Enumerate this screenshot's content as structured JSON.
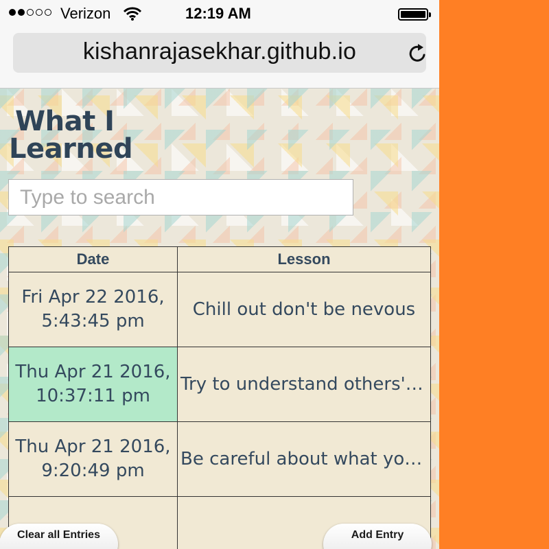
{
  "status_bar": {
    "signal_dots_filled": 2,
    "signal_dots_total": 5,
    "carrier": "Verizon",
    "time": "12:19 AM",
    "battery_level": 1.0
  },
  "browser": {
    "url": "kishanrajasekhar.github.io",
    "icons": [
      "wifi-icon",
      "reload-icon",
      "battery-icon"
    ]
  },
  "page": {
    "title_line1": "What I",
    "title_line2": "Learned",
    "search_placeholder": "Type to search"
  },
  "table": {
    "columns": [
      "Date",
      "Lesson"
    ],
    "rows": [
      {
        "date_line1": "Fri Apr 22 2016,",
        "date_line2": "5:43:45 pm",
        "lesson": "Chill out don't be nevous"
      },
      {
        "date_line1": "Thu Apr 21 2016,",
        "date_line2": "10:37:11 pm",
        "lesson": "Try to understand others' …"
      },
      {
        "date_line1": "Thu Apr 21 2016,",
        "date_line2": "9:20:49 pm",
        "lesson": "Be careful about what you …"
      }
    ]
  },
  "buttons": {
    "clear_label": "Clear all Entries",
    "add_label": "Add Entry"
  },
  "colors": {
    "side_panel": "#ff7f24",
    "highlight_cell": "#b3e9c9",
    "table_bg": "#f1e9d4",
    "text": "#34495e"
  }
}
